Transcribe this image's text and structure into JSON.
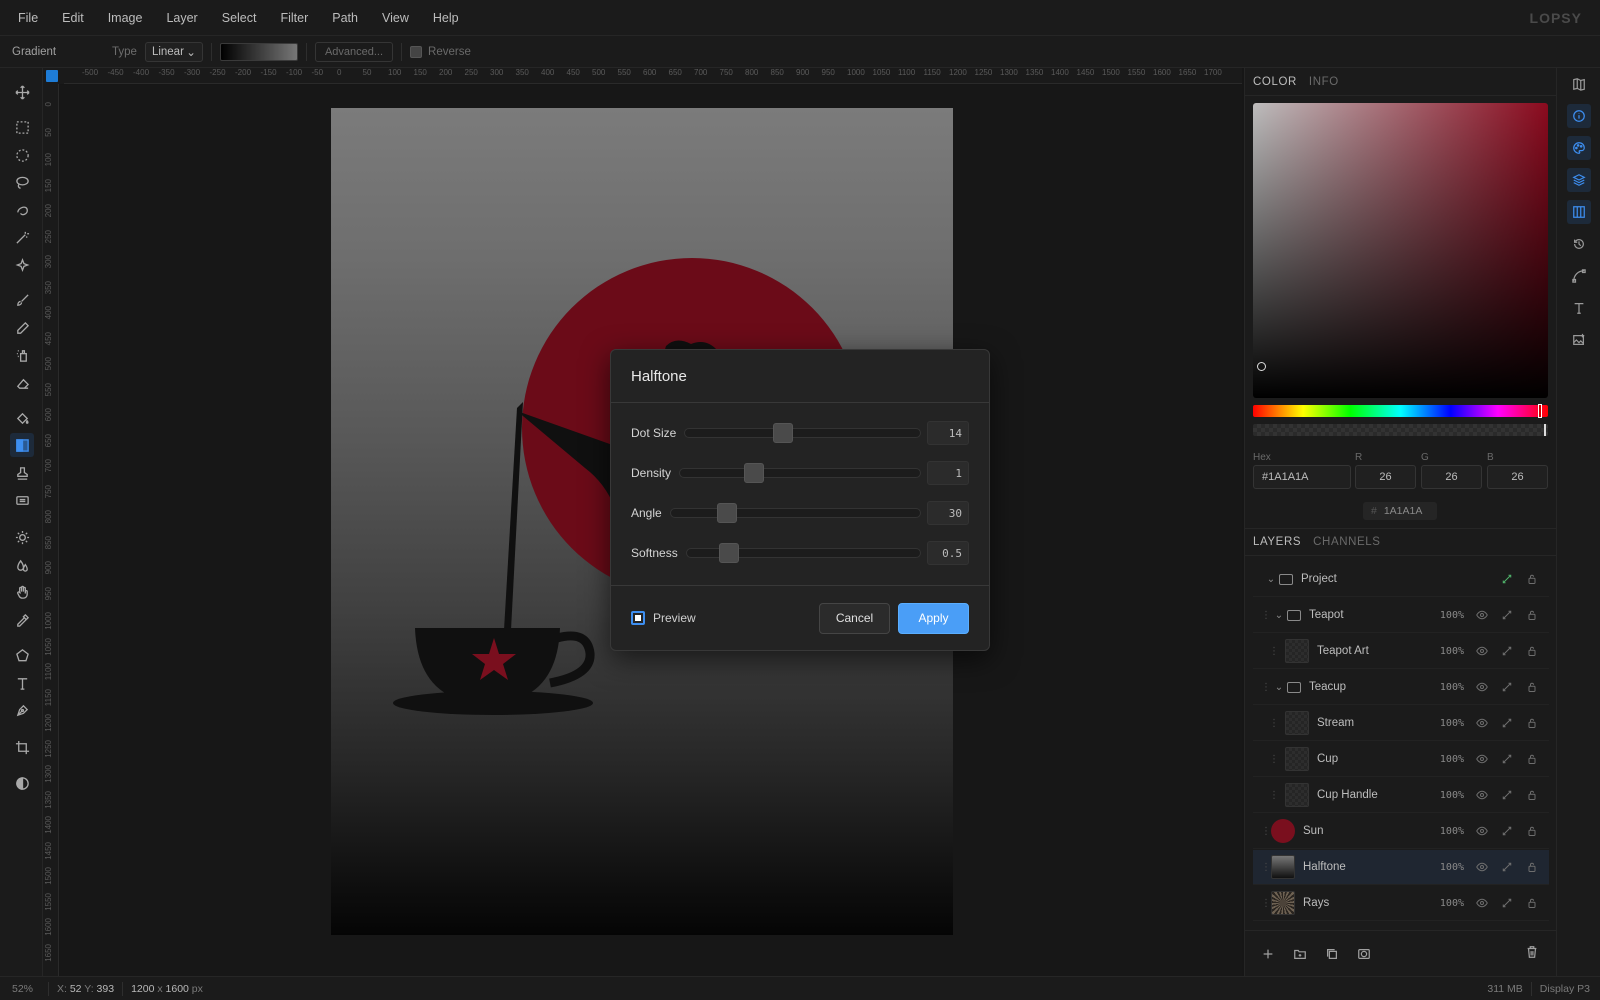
{
  "menu": [
    "File",
    "Edit",
    "Image",
    "Layer",
    "Select",
    "Filter",
    "Path",
    "View",
    "Help"
  ],
  "logo": "LOPSY",
  "options": {
    "tool": "Gradient",
    "type_label": "Type",
    "type_value": "Linear",
    "advanced_label": "Advanced...",
    "reverse_label": "Reverse"
  },
  "tools": [
    "move-icon",
    "marquee-rect-icon",
    "marquee-ellipse-icon",
    "lasso-icon",
    "quick-select-icon",
    "magic-wand-icon",
    "object-select-icon",
    "brush-icon",
    "pencil-icon",
    "spray-icon",
    "eraser-icon",
    "paint-bucket-icon",
    "gradient-icon",
    "stamp-icon",
    "patch-icon",
    "dodge-icon",
    "blur-icon",
    "hand-icon",
    "eyedropper-icon",
    "polygon-icon",
    "type-icon",
    "pen-icon",
    "crop-icon",
    "contrast-icon"
  ],
  "ruler": {
    "h": [
      "-500",
      "-450",
      "-400",
      "-350",
      "-300",
      "-250",
      "-200",
      "-150",
      "-100",
      "-50",
      "0",
      "50",
      "100",
      "150",
      "200",
      "250",
      "300",
      "350",
      "400",
      "450",
      "500",
      "550",
      "600",
      "650",
      "700",
      "750",
      "800",
      "850",
      "900",
      "950",
      "1000",
      "1050",
      "1100",
      "1150",
      "1200",
      "1250",
      "1300",
      "1350",
      "1400",
      "1450",
      "1500",
      "1550",
      "1600",
      "1650",
      "1700"
    ],
    "v": [
      "0",
      "50",
      "100",
      "150",
      "200",
      "250",
      "300",
      "350",
      "400",
      "450",
      "500",
      "550",
      "600",
      "650",
      "700",
      "750",
      "800",
      "850",
      "900",
      "950",
      "1000",
      "1050",
      "1100",
      "1150",
      "1200",
      "1250",
      "1300",
      "1350",
      "1400",
      "1450",
      "1500",
      "1550",
      "1600",
      "1650"
    ]
  },
  "dialog": {
    "title": "Halftone",
    "sliders": [
      {
        "label": "Dot Size",
        "value": "14",
        "position": 0.41
      },
      {
        "label": "Density",
        "value": "1",
        "position": 0.29
      },
      {
        "label": "Angle",
        "value": "30",
        "position": 0.2
      },
      {
        "label": "Softness",
        "value": "0.5",
        "position": 0.15
      }
    ],
    "preview_label": "Preview",
    "cancel_label": "Cancel",
    "apply_label": "Apply"
  },
  "color_panel": {
    "tabs": [
      "COLOR",
      "INFO"
    ],
    "hex_label": "Hex",
    "hex_value": "#1A1A1A",
    "r_label": "R",
    "g_label": "G",
    "b_label": "B",
    "r": "26",
    "g": "26",
    "b": "26",
    "hash": "#",
    "chip_value": "1A1A1A"
  },
  "layers_panel": {
    "tabs": [
      "LAYERS",
      "CHANNELS"
    ],
    "layers": [
      {
        "name": "Project",
        "kind": "folder",
        "depth": 0,
        "opacity": ""
      },
      {
        "name": "Teapot",
        "kind": "folder",
        "depth": 1,
        "opacity": "100%"
      },
      {
        "name": "Teapot Art",
        "kind": "layer",
        "depth": 2,
        "opacity": "100%"
      },
      {
        "name": "Teacup",
        "kind": "folder",
        "depth": 1,
        "opacity": "100%"
      },
      {
        "name": "Stream",
        "kind": "layer",
        "depth": 2,
        "opacity": "100%"
      },
      {
        "name": "Cup",
        "kind": "layer",
        "depth": 2,
        "opacity": "100%"
      },
      {
        "name": "Cup Handle",
        "kind": "layer",
        "depth": 2,
        "opacity": "100%"
      },
      {
        "name": "Sun",
        "kind": "sun",
        "depth": 1,
        "opacity": "100%"
      },
      {
        "name": "Halftone",
        "kind": "half",
        "depth": 1,
        "opacity": "100%",
        "selected": true
      },
      {
        "name": "Rays",
        "kind": "rays",
        "depth": 1,
        "opacity": "100%"
      }
    ]
  },
  "status": {
    "zoom": "52%",
    "x_label": "X:",
    "x": "52",
    "y_label": "Y:",
    "y": "393",
    "width": "1200",
    "x_sep": "x",
    "height": "1600",
    "unit": "px",
    "memory": "311 MB",
    "profile": "Display P3"
  },
  "colors": {
    "accent": "#3d8ef0",
    "apply": "#4a9ef7",
    "sun": "#7a0f1e"
  }
}
